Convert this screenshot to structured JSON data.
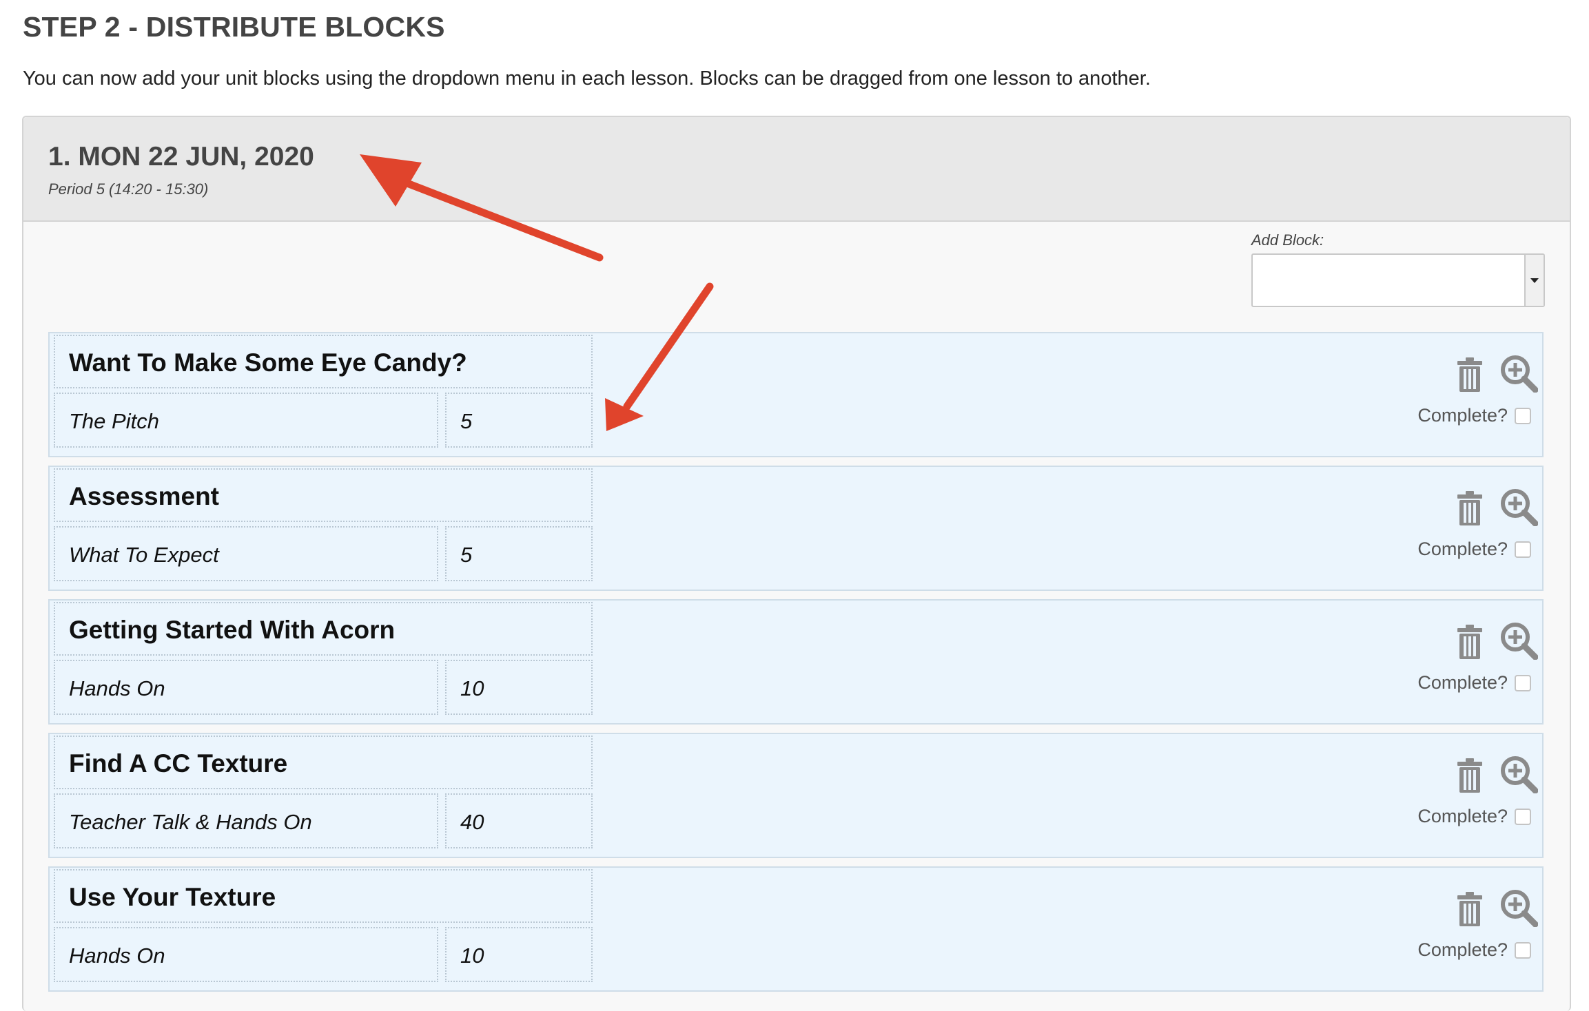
{
  "header": {
    "title": "STEP 2 - DISTRIBUTE BLOCKS",
    "intro": "You can now add your unit blocks using the dropdown menu in each lesson. Blocks can be dragged from one lesson to another."
  },
  "lesson": {
    "title": "1. MON 22 JUN, 2020",
    "period": "Period 5 (14:20 - 15:30)",
    "add_block": {
      "label": "Add Block:",
      "selected": ""
    },
    "blocks": [
      {
        "name": "Want To Make Some Eye Candy?",
        "type": "The Pitch",
        "minutes": "5",
        "complete_label": "Complete?",
        "complete": false
      },
      {
        "name": "Assessment",
        "type": "What To Expect",
        "minutes": "5",
        "complete_label": "Complete?",
        "complete": false
      },
      {
        "name": "Getting Started With Acorn",
        "type": "Hands On",
        "minutes": "10",
        "complete_label": "Complete?",
        "complete": false
      },
      {
        "name": "Find A CC Texture",
        "type": "Teacher Talk & Hands On",
        "minutes": "40",
        "complete_label": "Complete?",
        "complete": false
      },
      {
        "name": "Use Your Texture",
        "type": "Hands On",
        "minutes": "10",
        "complete_label": "Complete?",
        "complete": false
      }
    ]
  },
  "icons": {
    "delete": "trash-icon",
    "view": "zoom-in-icon",
    "dropdown": "caret-down-icon",
    "annotation": "arrow-icon"
  },
  "colors": {
    "block_bg": "#ebf5fd",
    "header_bg": "#e8e8e8",
    "annotation_arrow": "#e0442c",
    "icon_gray": "#888888"
  }
}
